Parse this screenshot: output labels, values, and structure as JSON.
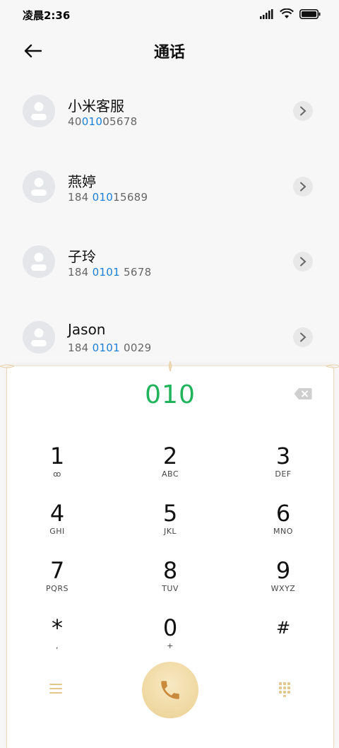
{
  "status": {
    "time": "凌晨2:36"
  },
  "header": {
    "title": "通话"
  },
  "contacts": [
    {
      "name": "小米客服",
      "num_pre": "40",
      "num_hl": "010",
      "num_post": "05678"
    },
    {
      "name": "燕婷",
      "num_pre": "184 ",
      "num_hl": "010",
      "num_post": "15689"
    },
    {
      "name": "子玲",
      "num_pre": "184 ",
      "num_hl": "0101",
      "num_post": " 5678"
    },
    {
      "name": "Jason",
      "num_pre": "184 ",
      "num_hl": "0101",
      "num_post": " 0029"
    }
  ],
  "dialer": {
    "number": "010",
    "accent_color": "#1fb35a",
    "keys": [
      {
        "digit": "1",
        "letters": "ꝏ"
      },
      {
        "digit": "2",
        "letters": "ABC"
      },
      {
        "digit": "3",
        "letters": "DEF"
      },
      {
        "digit": "4",
        "letters": "GHI"
      },
      {
        "digit": "5",
        "letters": "JKL"
      },
      {
        "digit": "6",
        "letters": "MNO"
      },
      {
        "digit": "7",
        "letters": "PQRS"
      },
      {
        "digit": "8",
        "letters": "TUV"
      },
      {
        "digit": "9",
        "letters": "WXYZ"
      },
      {
        "digit": "*",
        "letters": ","
      },
      {
        "digit": "0",
        "letters": "+"
      },
      {
        "digit": "#",
        "letters": ""
      }
    ]
  },
  "icons": {
    "back": "arrow-left-icon",
    "chevron": "chevron-right-icon",
    "backspace": "backspace-icon",
    "menu": "menu-icon",
    "call": "phone-icon",
    "dialpad": "dialpad-icon"
  }
}
